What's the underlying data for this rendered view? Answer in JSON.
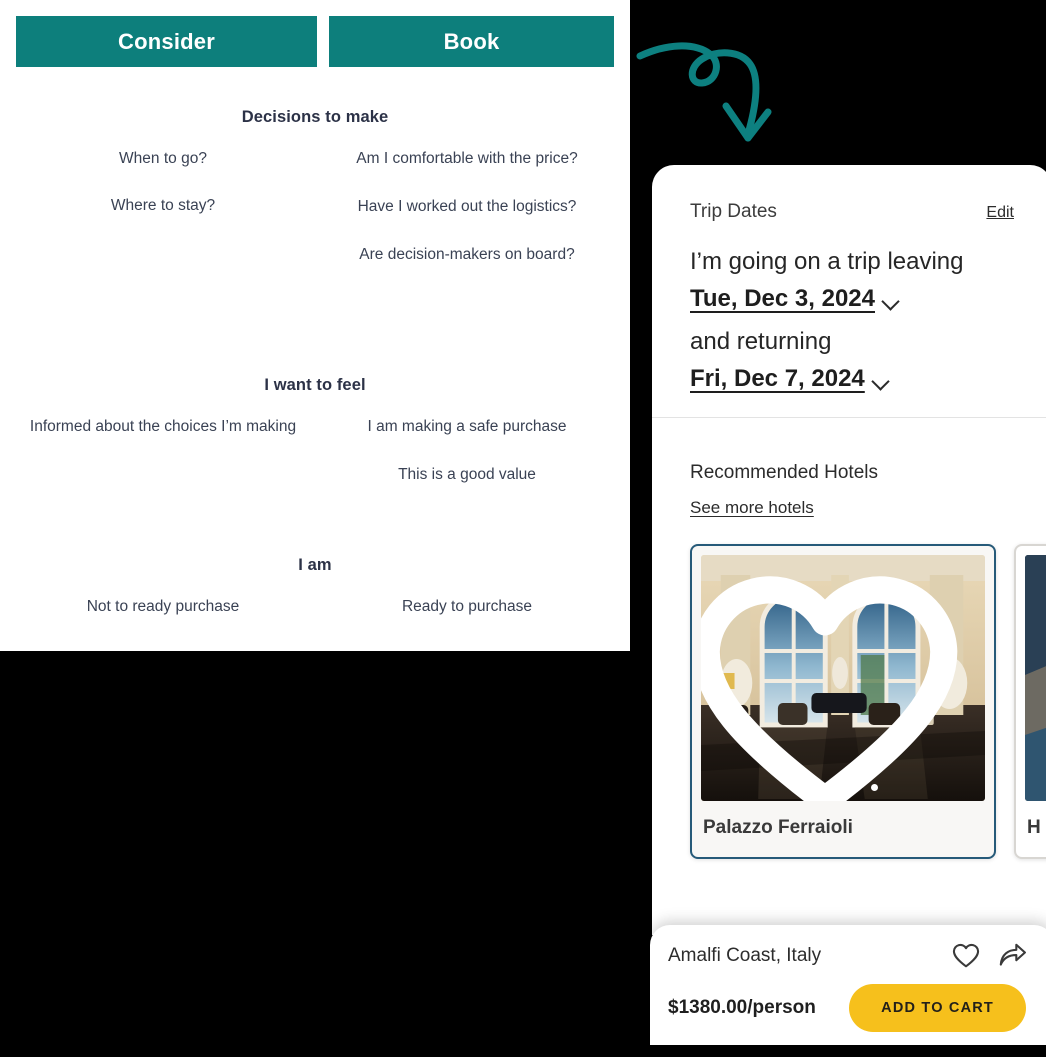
{
  "colors": {
    "teal": "#0d7f7c",
    "dark_navy_text": "#2c3247",
    "card_border": "#265a79",
    "cart_yellow": "#f6c01c",
    "panel_black": "#000000"
  },
  "left_panel": {
    "tabs": [
      {
        "label": "Consider",
        "selected": true
      },
      {
        "label": "Book",
        "selected": false
      }
    ],
    "sections": [
      {
        "title": "Decisions to make",
        "left_column": [
          "When to go?",
          "Where to stay?"
        ],
        "right_column": [
          "Am I comfortable with the price?",
          "Have I worked out the logistics?",
          "Are decision-makers on board?"
        ]
      },
      {
        "title": "I want to feel",
        "left_column": [
          "Informed about the choices I’m making"
        ],
        "right_column": [
          "I am making a safe purchase",
          "This is a good value"
        ]
      },
      {
        "title": "I am",
        "left_column": [
          "Not to ready purchase"
        ],
        "right_column": [
          "Ready to purchase"
        ]
      }
    ]
  },
  "right_panel": {
    "doodle": "curly-arrow-icon",
    "trip_card": {
      "header_label": "Trip Dates",
      "edit_label": "Edit",
      "leaving_text": "I’m going on a trip leaving",
      "depart_date": "Tue, Dec 3, 2024",
      "returning_text": "and returning",
      "return_date": "Fri, Dec 7, 2024",
      "depart_chevron": "chevron-down-icon",
      "return_chevron": "chevron-down-icon"
    },
    "hotels": {
      "title": "Recommended Hotels",
      "see_more_label": "See more hotels",
      "carousel_dots": 4,
      "active_dot": 0,
      "cards": [
        {
          "name": "Palazzo Ferraioli",
          "favorite_icon": "heart-outline-icon",
          "image_alt": "hotel-lobby-photo",
          "selected": true
        },
        {
          "name": "H",
          "image_alt": "coastal-cliff-photo",
          "selected": false
        }
      ]
    },
    "bottom_bar": {
      "location": "Amalfi Coast, Italy",
      "favorite_icon": "heart-outline-icon",
      "share_icon": "share-arrow-icon",
      "price": "$1380.00/person",
      "cart_label": "ADD TO CART"
    }
  }
}
